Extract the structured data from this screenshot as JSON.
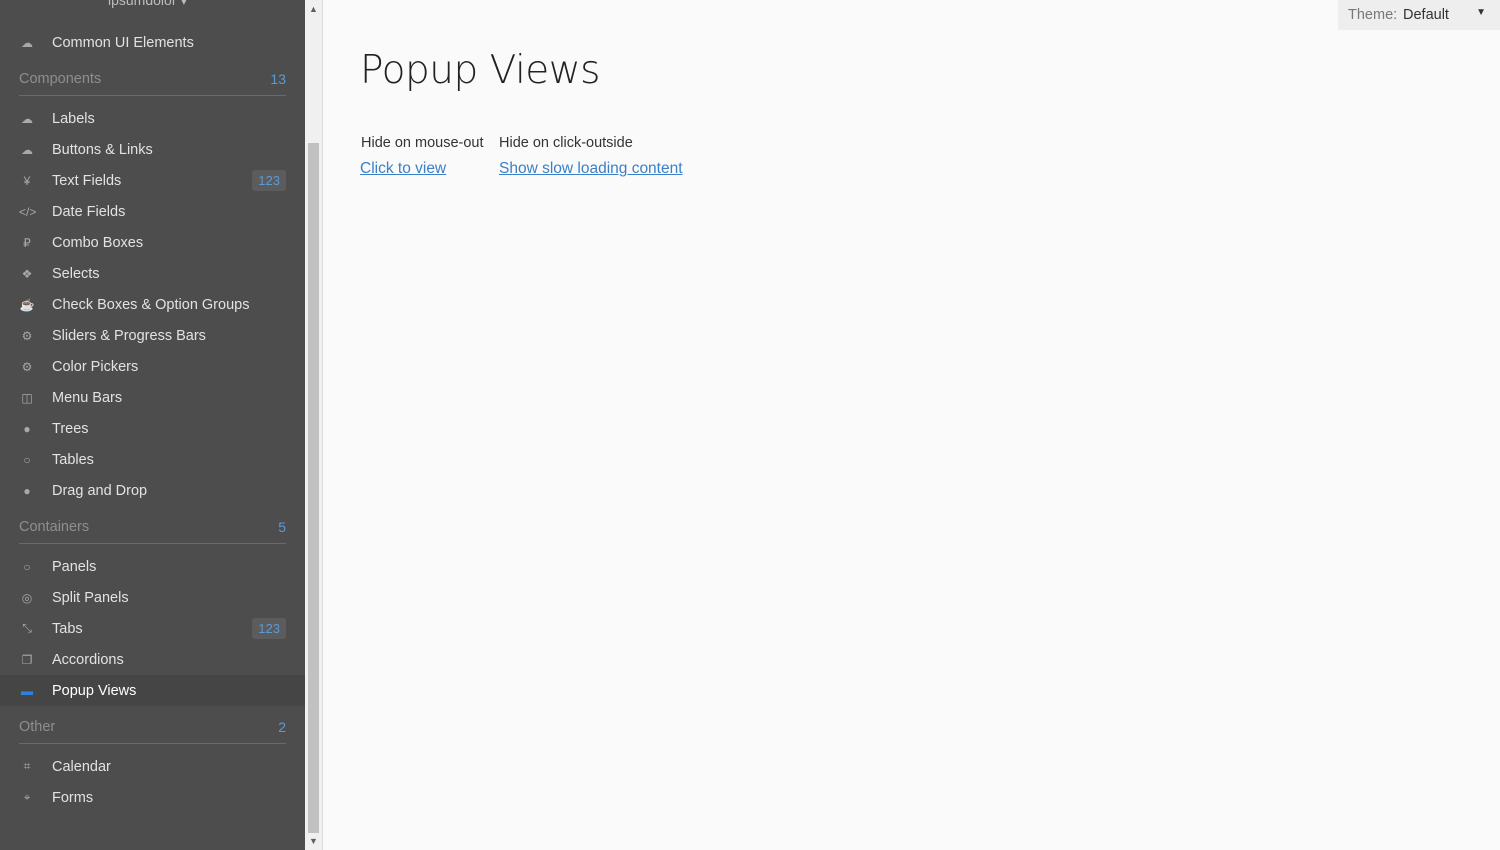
{
  "sidebar": {
    "user_menu": "ipsumdolor ▾",
    "top_item": {
      "icon": "cloud-icon",
      "glyph": "☁",
      "label": "Common UI Elements"
    },
    "sections": [
      {
        "title": "Components",
        "count": "13",
        "items": [
          {
            "icon": "cloud-upload-icon",
            "glyph": "☁",
            "label": "Labels",
            "badge": ""
          },
          {
            "icon": "cloud-download-icon",
            "glyph": "☁",
            "label": "Buttons & Links",
            "badge": ""
          },
          {
            "icon": "yen-icon",
            "glyph": "¥",
            "label": "Text Fields",
            "badge": "123"
          },
          {
            "icon": "code-icon",
            "glyph": "</>",
            "label": "Date Fields",
            "badge": ""
          },
          {
            "icon": "ruble-icon",
            "glyph": "₽",
            "label": "Combo Boxes",
            "badge": ""
          },
          {
            "icon": "codepen-icon",
            "glyph": "❖",
            "label": "Selects",
            "badge": ""
          },
          {
            "icon": "coffee-icon",
            "glyph": "☕",
            "label": "Check Boxes & Option Groups",
            "badge": ""
          },
          {
            "icon": "cog-icon",
            "glyph": "⚙",
            "label": "Sliders & Progress Bars",
            "badge": ""
          },
          {
            "icon": "cogs-icon",
            "glyph": "⚙",
            "label": "Color Pickers",
            "badge": ""
          },
          {
            "icon": "columns-icon",
            "glyph": "◫",
            "label": "Menu Bars",
            "badge": ""
          },
          {
            "icon": "comment-icon",
            "glyph": "●",
            "label": "Trees",
            "badge": ""
          },
          {
            "icon": "comment-outline-icon",
            "glyph": "○",
            "label": "Tables",
            "badge": ""
          },
          {
            "icon": "comments-icon",
            "glyph": "●",
            "label": "Drag and Drop",
            "badge": ""
          }
        ]
      },
      {
        "title": "Containers",
        "count": "5",
        "items": [
          {
            "icon": "comments-outline-icon",
            "glyph": "○",
            "label": "Panels",
            "badge": ""
          },
          {
            "icon": "compass-icon",
            "glyph": "◎",
            "label": "Split Panels",
            "badge": ""
          },
          {
            "icon": "compress-icon",
            "glyph": "⤡",
            "label": "Tabs",
            "badge": "123"
          },
          {
            "icon": "copy-icon",
            "glyph": "❐",
            "label": "Accordions",
            "badge": ""
          },
          {
            "icon": "credit-card-icon",
            "glyph": "▬",
            "label": "Popup Views",
            "badge": "",
            "selected": true
          }
        ]
      },
      {
        "title": "Other",
        "count": "2",
        "items": [
          {
            "icon": "crop-icon",
            "glyph": "⌗",
            "label": "Calendar",
            "badge": ""
          },
          {
            "icon": "crosshairs-icon",
            "glyph": "⌖",
            "label": "Forms",
            "badge": ""
          }
        ]
      }
    ]
  },
  "main": {
    "title": "Popup Views",
    "columns": [
      {
        "label": "Hide on mouse-out",
        "link": "Click to view"
      },
      {
        "label": "Hide on click-outside",
        "link": "Show slow loading content"
      }
    ]
  },
  "theme": {
    "label": "Theme:",
    "value": "Default",
    "arrow": "▼"
  },
  "scrollbar": {
    "up": "▲",
    "down": "▼"
  },
  "colors": {
    "sidebar_bg": "#4d4d4d",
    "accent": "#5b9bd5",
    "link": "#3a80c8",
    "selected_icon": "#2f7fdc"
  }
}
